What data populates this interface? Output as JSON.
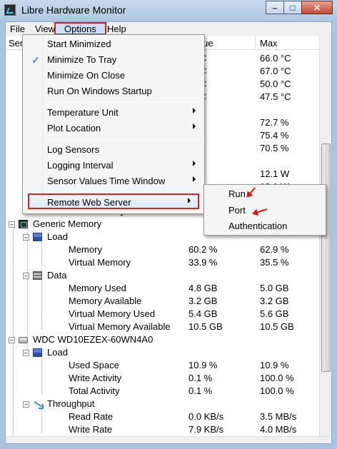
{
  "window": {
    "title": "Libre Hardware Monitor",
    "minimize": "–",
    "maximize": "□",
    "close": "✕"
  },
  "menubar": {
    "file": "File",
    "view": "View",
    "options": "Options",
    "help": "Help"
  },
  "columns": {
    "sensor": "Ser",
    "value": "ue",
    "max": "Max"
  },
  "partial_rows": [
    {
      "value": "0 °C",
      "max": "66.0 °C"
    },
    {
      "value": "0 °C",
      "max": "67.0 °C"
    },
    {
      "value": "0 °C",
      "max": "50.0 °C"
    },
    {
      "value": "0 °C",
      "max": "47.5 °C"
    },
    {
      "value": "%",
      "max": "72.7 %"
    },
    {
      "value": "%",
      "max": "75.4 %"
    },
    {
      "value": "0 %",
      "max": "70.5 %"
    },
    {
      "value": "W",
      "max": "12.1 W"
    },
    {
      "value": "",
      "max": "10.1 W"
    }
  ],
  "gpu_memory_partial": "GPU Memory",
  "tree": [
    {
      "label": "Generic Memory"
    },
    {
      "label": "Load"
    },
    {
      "label": "Memory",
      "value": "60.2 %",
      "max": "62.9 %"
    },
    {
      "label": "Virtual Memory",
      "value": "33.9 %",
      "max": "35.5 %"
    },
    {
      "label": "Data"
    },
    {
      "label": "Memory Used",
      "value": "4.8 GB",
      "max": "5.0 GB"
    },
    {
      "label": "Memory Available",
      "value": "3.2 GB",
      "max": "3.2 GB"
    },
    {
      "label": "Virtual Memory Used",
      "value": "5.4 GB",
      "max": "5.6 GB"
    },
    {
      "label": "Virtual Memory Available",
      "value": "10.5 GB",
      "max": "10.5 GB"
    },
    {
      "label": "WDC WD10EZEX-60WN4A0"
    },
    {
      "label": "Load"
    },
    {
      "label": "Used Space",
      "value": "10.9 %",
      "max": "10.9 %"
    },
    {
      "label": "Write Activity",
      "value": "0.1 %",
      "max": "100.0 %"
    },
    {
      "label": "Total Activity",
      "value": "0.1 %",
      "max": "100.0 %"
    },
    {
      "label": "Throughput"
    },
    {
      "label": "Read Rate",
      "value": "0.0 KB/s",
      "max": "3.5 MB/s"
    },
    {
      "label": "Write Rate",
      "value": "7.9 KB/s",
      "max": "4.0 MB/s"
    }
  ],
  "options_menu": {
    "start_minimized": "Start Minimized",
    "minimize_to_tray": "Minimize To Tray",
    "minimize_on_close": "Minimize On Close",
    "run_on_startup": "Run On Windows Startup",
    "temperature_unit": "Temperature Unit",
    "plot_location": "Plot Location",
    "log_sensors": "Log Sensors",
    "logging_interval": "Logging Interval",
    "sensor_window": "Sensor Values Time Window",
    "remote_web_server": "Remote Web Server",
    "check": "✓"
  },
  "remote_submenu": {
    "run": "Run",
    "port": "Port",
    "authentication": "Authentication"
  },
  "colors": {
    "highlight_box": "#e02020",
    "title_bg": "#aec8e2"
  }
}
